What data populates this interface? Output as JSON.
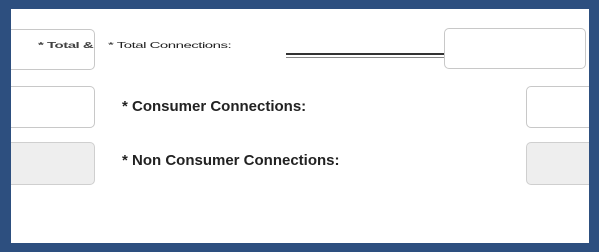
{
  "form": {
    "total_label_ghost": "* Total &",
    "total_label": "* Total Connections:",
    "consumer_label": "* Consumer Connections:",
    "non_consumer_label": "* Non Consumer Connections:",
    "total_value": "",
    "consumer_value": "",
    "non_consumer_value": "",
    "non_consumer_disabled": true
  },
  "colors": {
    "frame": "#2d4f7f",
    "panel": "#ffffff",
    "field_border": "#c8c8c8",
    "field_disabled": "#eeeeee"
  }
}
